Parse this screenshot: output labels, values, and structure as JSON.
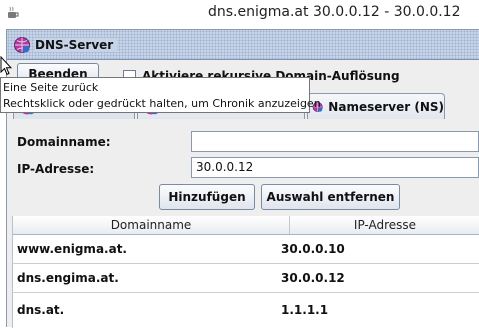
{
  "window": {
    "title": "dns.enigma.at 30.0.0.12 - 30.0.0.12",
    "app_icon": "java-cup-icon"
  },
  "frame": {
    "title": "DNS-Server",
    "icon": "dns-globe-icon"
  },
  "toolbar": {
    "quit_label": "Beenden",
    "recursive_checkbox_label": "Aktiviere rekursive Domain-Auflösung",
    "recursive_checked": false
  },
  "tabs": [
    {
      "label": "",
      "icon": "dns-globe-icon",
      "selected": true
    },
    {
      "label": "",
      "icon": "dns-globe-icon",
      "selected": false
    },
    {
      "label": "Nameserver (NS)",
      "icon": "dns-globe-icon",
      "selected": false
    }
  ],
  "form": {
    "domain_label": "Domainname:",
    "domain_value": "",
    "ip_label": "IP-Adresse:",
    "ip_value": "30.0.0.12",
    "add_button": "Hinzufügen",
    "remove_button": "Auswahl entfernen"
  },
  "table": {
    "columns": [
      "Domainname",
      "IP-Adresse"
    ],
    "rows": [
      {
        "domain": "www.enigma.at.",
        "ip": "30.0.0.10"
      },
      {
        "domain": "dns.engima.at.",
        "ip": "30.0.0.12"
      },
      {
        "domain": "dns.at.",
        "ip": "1.1.1.1"
      }
    ]
  },
  "tooltip": {
    "line1": "Eine Seite zurück",
    "line2": "Rechtsklick oder gedrückt halten, um Chronik anzuzeigen"
  }
}
